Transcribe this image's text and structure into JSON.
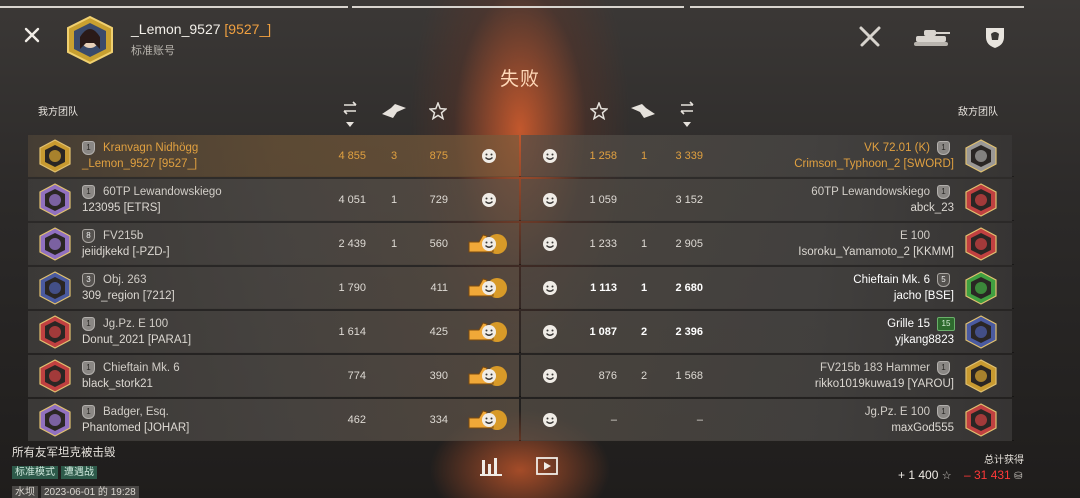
{
  "header": {
    "player_name": "_Lemon_9527",
    "player_clan": "[9527_]",
    "account_type": "标准账号",
    "result": "失败",
    "icons": [
      "close-icon",
      "crossed-swords-icon",
      "tank-icon",
      "lion-crest-icon"
    ]
  },
  "teams": {
    "ally_label": "我方团队",
    "enemy_label": "敌方团队",
    "column_icons": [
      "sort-icon",
      "damage-icon",
      "star-icon"
    ]
  },
  "ally": [
    {
      "tier": "1",
      "tank": "Kranvagn Nidhögg",
      "player": "_Lemon_9527 [9527_]",
      "damage": "4 855",
      "kills": "3",
      "xp": "875",
      "me": true,
      "medal": ""
    },
    {
      "tier": "1",
      "tank": "60TP Lewandowskiego",
      "player": "123095 [ETRS]",
      "damage": "4 051",
      "kills": "1",
      "xp": "729",
      "medal": ""
    },
    {
      "tier": "8",
      "tank": "FV215b",
      "player": "jeiidjkekd [-PZD-]",
      "damage": "2 439",
      "kills": "1",
      "xp": "560",
      "medal": "1"
    },
    {
      "tier": "3",
      "tank": "Obj. 263",
      "player": "309_region [7212]",
      "damage": "1 790",
      "kills": "",
      "xp": "411",
      "medal": "1"
    },
    {
      "tier": "1",
      "tank": "Jg.Pz. E 100",
      "player": "Donut_2021 [PARA1]",
      "damage": "1 614",
      "kills": "",
      "xp": "425",
      "medal": "1"
    },
    {
      "tier": "1",
      "tank": "Chieftain Mk. 6",
      "player": "black_stork21",
      "damage": "774",
      "kills": "",
      "xp": "390",
      "medal": "1"
    },
    {
      "tier": "1",
      "tank": "Badger, Esq.",
      "player": "Phantomed [JOHAR]",
      "damage": "462",
      "kills": "",
      "xp": "334",
      "medal": "1"
    }
  ],
  "enemy": [
    {
      "tier": "1",
      "tank": "VK 72.01 (K)",
      "player": "Crimson_Typhoon_2 [SWORD]",
      "damage": "1 258",
      "kills": "1",
      "xp": "3 339",
      "bold": false
    },
    {
      "tier": "1",
      "tank": "60TP Lewandowskiego",
      "player": "abck_23",
      "damage": "1 059",
      "kills": "",
      "xp": "3 152",
      "bold": false
    },
    {
      "tier": "",
      "tank": "E 100",
      "player": "Isoroku_Yamamoto_2 [KKMM]",
      "damage": "1 233",
      "kills": "1",
      "xp": "2 905",
      "bold": false
    },
    {
      "tier": "5",
      "tank": "Chieftain Mk. 6",
      "player": "jacho [BSE]",
      "damage": "1 113",
      "kills": "1",
      "xp": "2 680",
      "bold": true
    },
    {
      "tier": "15",
      "tank": "Grille 15",
      "player": "yjkang8823",
      "damage": "1 087",
      "kills": "2",
      "xp": "2 396",
      "bold": true
    },
    {
      "tier": "1",
      "tank": "FV215b 183 Hammer",
      "player": "rikko1019kuwa19 [YAROU]",
      "damage": "876",
      "kills": "2",
      "xp": "1 568",
      "bold": false
    },
    {
      "tier": "1",
      "tank": "Jg.Pz. E 100",
      "player": "maxGod555",
      "damage": "–",
      "kills": "",
      "xp": "–",
      "bold": false
    }
  ],
  "footer": {
    "status": "所有友军坦克被击毁",
    "mode": "标准模式",
    "battle_type": "遭遇战",
    "map": "水坝",
    "datetime": "2023-06-01 的 19:28",
    "totals_label": "总计获得",
    "credits": "+ 1 400",
    "gold": "– 31 431"
  }
}
